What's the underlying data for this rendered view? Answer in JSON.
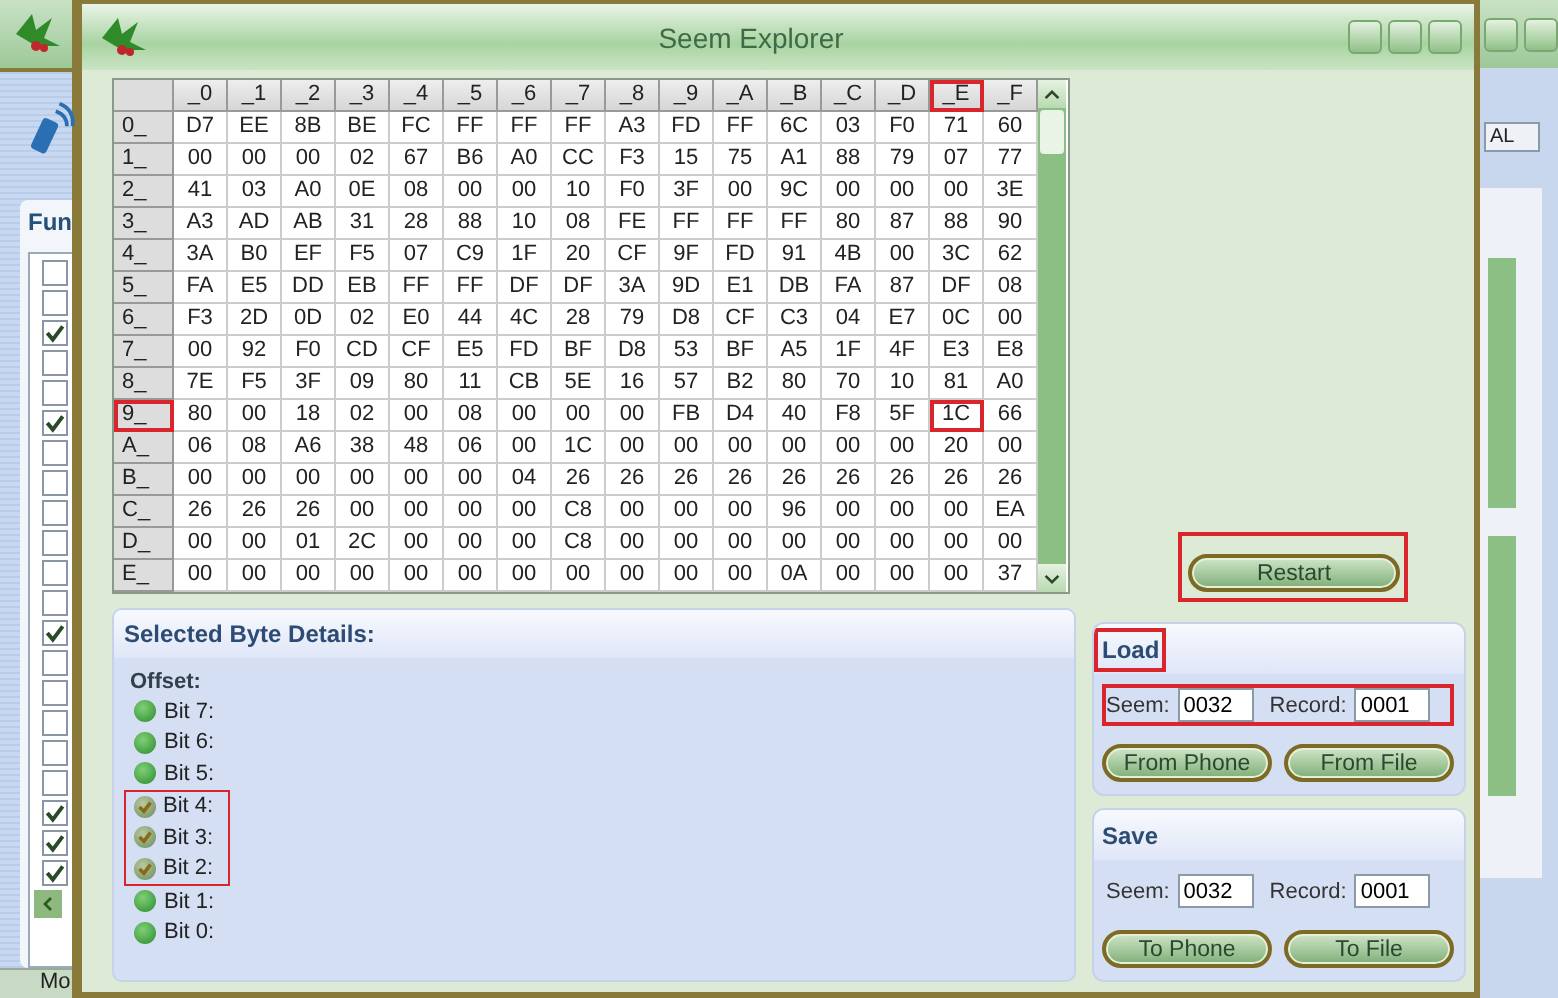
{
  "window": {
    "title": "Seem Explorer"
  },
  "background_window": {
    "panel_title": "Fun",
    "status": "Mo",
    "button": "AL",
    "checkboxes": [
      {
        "checked": false
      },
      {
        "checked": false
      },
      {
        "checked": true
      },
      {
        "checked": false
      },
      {
        "checked": false
      },
      {
        "checked": true
      },
      {
        "checked": false
      },
      {
        "checked": false
      },
      {
        "checked": false
      },
      {
        "checked": false
      },
      {
        "checked": false
      },
      {
        "checked": false
      },
      {
        "checked": true
      },
      {
        "checked": false
      },
      {
        "checked": false
      },
      {
        "checked": false
      },
      {
        "checked": false
      },
      {
        "checked": false
      },
      {
        "checked": true
      },
      {
        "checked": true
      },
      {
        "checked": true
      }
    ]
  },
  "hex_table": {
    "columns": [
      {
        "label": "_0",
        "highlighted": false
      },
      {
        "label": "_1",
        "highlighted": false
      },
      {
        "label": "_2",
        "highlighted": false
      },
      {
        "label": "_3",
        "highlighted": false
      },
      {
        "label": "_4",
        "highlighted": false
      },
      {
        "label": "_5",
        "highlighted": false
      },
      {
        "label": "_6",
        "highlighted": false
      },
      {
        "label": "_7",
        "highlighted": false
      },
      {
        "label": "_8",
        "highlighted": false
      },
      {
        "label": "_9",
        "highlighted": false
      },
      {
        "label": "_A",
        "highlighted": false
      },
      {
        "label": "_B",
        "highlighted": false
      },
      {
        "label": "_C",
        "highlighted": false
      },
      {
        "label": "_D",
        "highlighted": false
      },
      {
        "label": "_E",
        "highlighted": true
      },
      {
        "label": "_F",
        "highlighted": false
      }
    ],
    "rows": [
      {
        "label": "0_",
        "highlighted": false,
        "cells": [
          "D7",
          "EE",
          "8B",
          "BE",
          "FC",
          "FF",
          "FF",
          "FF",
          "A3",
          "FD",
          "FF",
          "6C",
          "03",
          "F0",
          "71",
          "60"
        ]
      },
      {
        "label": "1_",
        "highlighted": false,
        "cells": [
          "00",
          "00",
          "00",
          "02",
          "67",
          "B6",
          "A0",
          "CC",
          "F3",
          "15",
          "75",
          "A1",
          "88",
          "79",
          "07",
          "77"
        ]
      },
      {
        "label": "2_",
        "highlighted": false,
        "cells": [
          "41",
          "03",
          "A0",
          "0E",
          "08",
          "00",
          "00",
          "10",
          "F0",
          "3F",
          "00",
          "9C",
          "00",
          "00",
          "00",
          "3E"
        ]
      },
      {
        "label": "3_",
        "highlighted": false,
        "cells": [
          "A3",
          "AD",
          "AB",
          "31",
          "28",
          "88",
          "10",
          "08",
          "FE",
          "FF",
          "FF",
          "FF",
          "80",
          "87",
          "88",
          "90"
        ]
      },
      {
        "label": "4_",
        "highlighted": false,
        "cells": [
          "3A",
          "B0",
          "EF",
          "F5",
          "07",
          "C9",
          "1F",
          "20",
          "CF",
          "9F",
          "FD",
          "91",
          "4B",
          "00",
          "3C",
          "62"
        ]
      },
      {
        "label": "5_",
        "highlighted": false,
        "cells": [
          "FA",
          "E5",
          "DD",
          "EB",
          "FF",
          "FF",
          "DF",
          "DF",
          "3A",
          "9D",
          "E1",
          "DB",
          "FA",
          "87",
          "DF",
          "08"
        ]
      },
      {
        "label": "6_",
        "highlighted": false,
        "cells": [
          "F3",
          "2D",
          "0D",
          "02",
          "E0",
          "44",
          "4C",
          "28",
          "79",
          "D8",
          "CF",
          "C3",
          "04",
          "E7",
          "0C",
          "00"
        ]
      },
      {
        "label": "7_",
        "highlighted": false,
        "cells": [
          "00",
          "92",
          "F0",
          "CD",
          "CF",
          "E5",
          "FD",
          "BF",
          "D8",
          "53",
          "BF",
          "A5",
          "1F",
          "4F",
          "E3",
          "E8"
        ]
      },
      {
        "label": "8_",
        "highlighted": false,
        "cells": [
          "7E",
          "F5",
          "3F",
          "09",
          "80",
          "11",
          "CB",
          "5E",
          "16",
          "57",
          "B2",
          "80",
          "70",
          "10",
          "81",
          "A0"
        ]
      },
      {
        "label": "9_",
        "highlighted": true,
        "cells": [
          "80",
          "00",
          "18",
          "02",
          "00",
          "08",
          "00",
          "00",
          "00",
          "FB",
          "D4",
          "40",
          "F8",
          "5F",
          "1C",
          "66"
        ]
      },
      {
        "label": "A_",
        "highlighted": false,
        "cells": [
          "06",
          "08",
          "A6",
          "38",
          "48",
          "06",
          "00",
          "1C",
          "00",
          "00",
          "00",
          "00",
          "00",
          "00",
          "20",
          "00"
        ]
      },
      {
        "label": "B_",
        "highlighted": false,
        "cells": [
          "00",
          "00",
          "00",
          "00",
          "00",
          "00",
          "04",
          "26",
          "26",
          "26",
          "26",
          "26",
          "26",
          "26",
          "26",
          "26"
        ]
      },
      {
        "label": "C_",
        "highlighted": false,
        "cells": [
          "26",
          "26",
          "26",
          "00",
          "00",
          "00",
          "00",
          "C8",
          "00",
          "00",
          "00",
          "96",
          "00",
          "00",
          "00",
          "EA"
        ]
      },
      {
        "label": "D_",
        "highlighted": false,
        "cells": [
          "00",
          "00",
          "01",
          "2C",
          "00",
          "00",
          "00",
          "C8",
          "00",
          "00",
          "00",
          "00",
          "00",
          "00",
          "00",
          "00"
        ]
      },
      {
        "label": "E_",
        "highlighted": false,
        "cells": [
          "00",
          "00",
          "00",
          "00",
          "00",
          "00",
          "00",
          "00",
          "00",
          "00",
          "00",
          "0A",
          "00",
          "00",
          "00",
          "37"
        ]
      }
    ]
  },
  "details": {
    "title": "Selected Byte Details:",
    "offset_label": "Offset:",
    "bits": [
      {
        "label": "Bit 7:",
        "checked": false,
        "highlighted": false
      },
      {
        "label": "Bit 6:",
        "checked": false,
        "highlighted": false
      },
      {
        "label": "Bit 5:",
        "checked": false,
        "highlighted": false
      },
      {
        "label": "Bit 4:",
        "checked": true,
        "highlighted": true
      },
      {
        "label": "Bit 3:",
        "checked": true,
        "highlighted": true
      },
      {
        "label": "Bit 2:",
        "checked": true,
        "highlighted": true
      },
      {
        "label": "Bit 1:",
        "checked": false,
        "highlighted": false
      },
      {
        "label": "Bit 0:",
        "checked": false,
        "highlighted": false
      }
    ]
  },
  "restart": {
    "label": "Restart",
    "highlighted": true
  },
  "panels": [
    {
      "title": "Load",
      "title_highlighted": true,
      "fields_highlighted": true,
      "seem_label": "Seem:",
      "seem": "0032",
      "record_label": "Record:",
      "record": "0001",
      "buttons": [
        "From Phone",
        "From File"
      ]
    },
    {
      "title": "Save",
      "title_highlighted": false,
      "fields_highlighted": false,
      "seem_label": "Seem:",
      "seem": "0032",
      "record_label": "Record:",
      "record": "0001",
      "buttons": [
        "To Phone",
        "To File"
      ]
    }
  ]
}
